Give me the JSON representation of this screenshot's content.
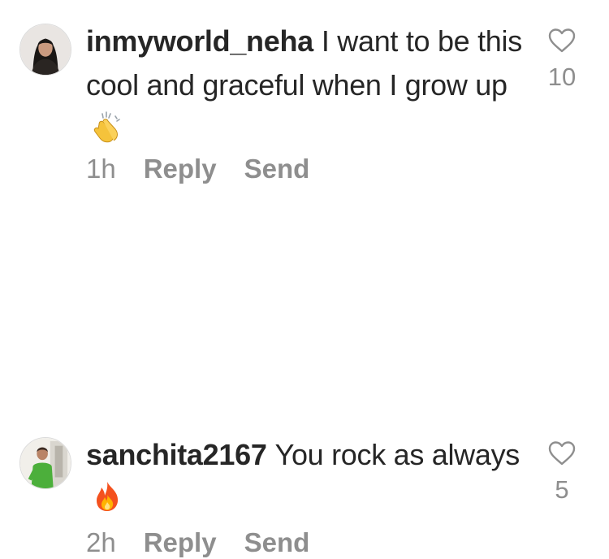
{
  "comments": [
    {
      "username": "inmyworld_neha",
      "text": "I want to be this cool and graceful when I grow up",
      "emoji": "clapping-hands-icon",
      "time": "1h",
      "reply_label": "Reply",
      "send_label": "Send",
      "likes": "10"
    },
    {
      "username": "sanchita2167",
      "text": "You rock as always",
      "emoji": "fire-icon",
      "time": "2h",
      "reply_label": "Reply",
      "send_label": "Send",
      "likes": "5"
    }
  ],
  "colors": {
    "text": "#262626",
    "secondary": "#8e8e8e",
    "background": "#ffffff"
  }
}
